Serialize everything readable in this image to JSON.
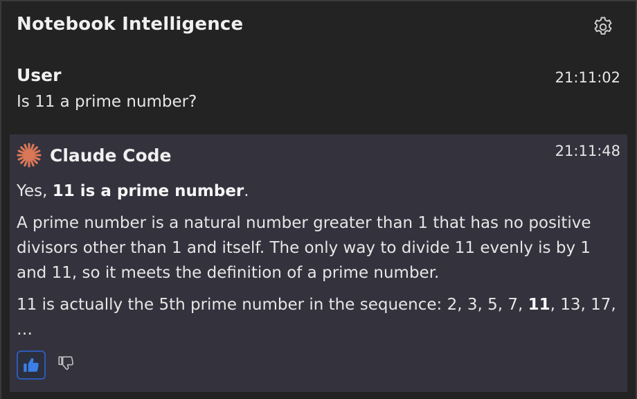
{
  "header": {
    "title": "Notebook Intelligence",
    "settings_icon": "gear-icon"
  },
  "messages": [
    {
      "sender": "User",
      "time": "21:11:02",
      "text": "Is 11 a prime number?"
    },
    {
      "sender": "Claude Code",
      "time": "21:11:48",
      "icon": "claude-sparkle-icon",
      "paragraphs": [
        {
          "pre": "Yes, ",
          "bold": "11 is a prime number",
          "post": "."
        },
        {
          "text": "A prime number is a natural number greater than 1 that has no positive divisors other than 1 and itself. The only way to divide 11 evenly is by 1 and 11, so it meets the definition of a prime number."
        },
        {
          "pre": "11 is actually the 5th prime number in the sequence: 2, 3, 5, 7, ",
          "bold": "11",
          "post": ", 13, 17, …"
        }
      ],
      "feedback": {
        "thumbs_up_icon": "thumbs-up-icon",
        "thumbs_down_icon": "thumbs-down-icon",
        "selected": "thumbs-up"
      }
    }
  ],
  "colors": {
    "background": "#232323",
    "assistant_background": "#33323d",
    "claude_icon": "#d97757",
    "thumbs_up_selected": "#3b7ee8",
    "thumbs_up_border": "#2f5bb7"
  }
}
